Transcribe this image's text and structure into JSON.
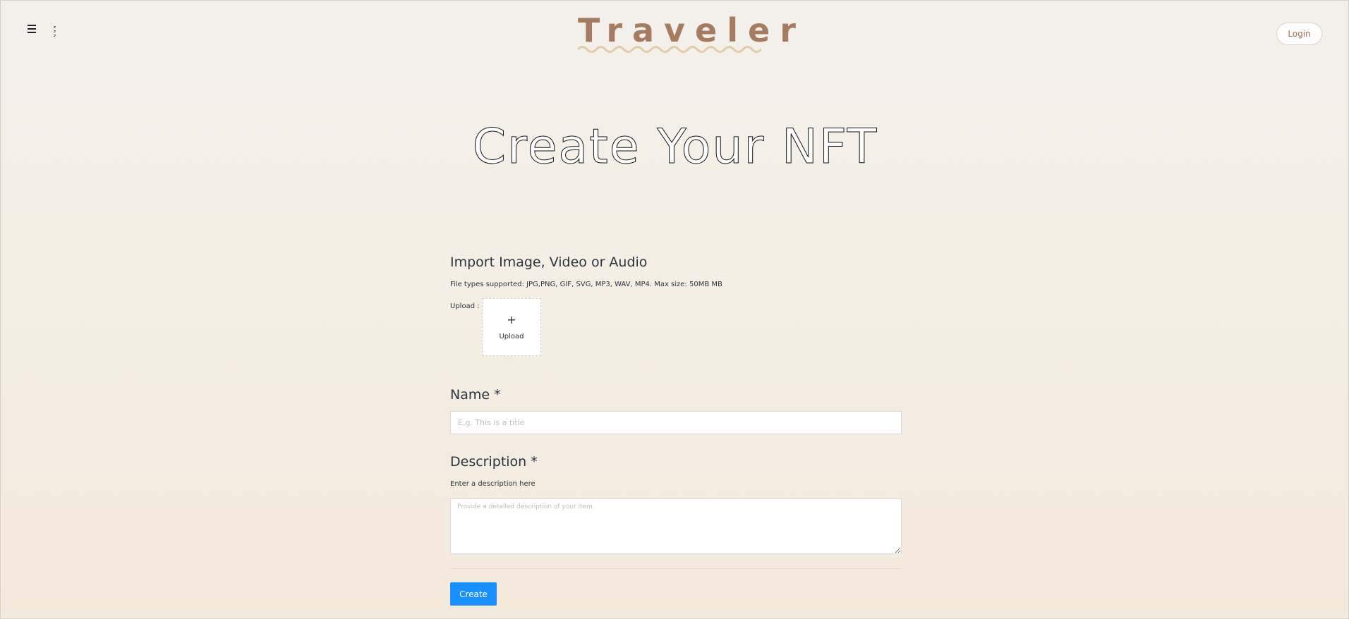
{
  "header": {
    "logo_text": "Traveler",
    "login_label": "Login"
  },
  "hero": {
    "title": "Create Your NFT"
  },
  "form": {
    "import_title": "Import Image, Video or Audio",
    "file_types": "File types supported: JPG,PNG, GIF, SVG, MP3, WAV, MP4. Max size: 50MB MB",
    "upload_label": "Upload :",
    "upload_plus": "+",
    "upload_button_label": "Upload",
    "name_title": "Name *",
    "name_placeholder": "E.g. This is a title",
    "description_title": "Description *",
    "description_hint": "Enter a description here",
    "description_placeholder": "Provide a detailed description of your item.",
    "create_label": "Create"
  },
  "colors": {
    "accent_brand": "#a57c5f",
    "primary_button": "#1890ff"
  }
}
